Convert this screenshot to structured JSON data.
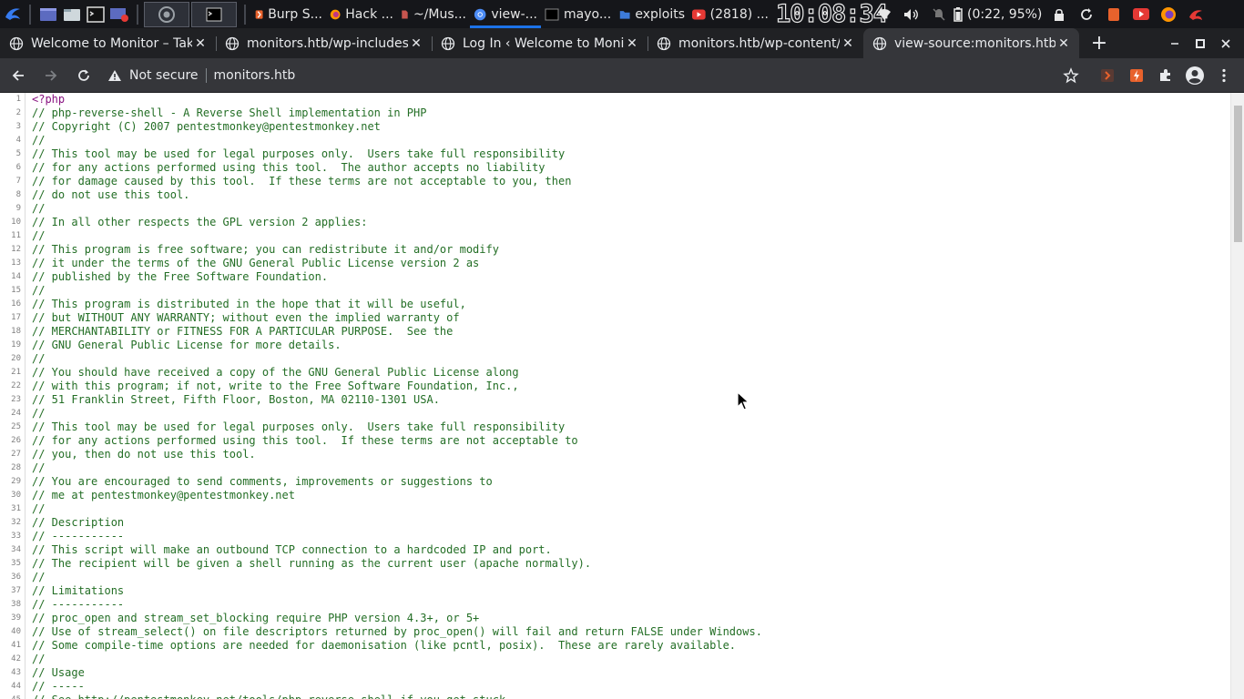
{
  "taskbar": {
    "pinned": [
      {
        "name": "chrome",
        "color": "#4b8bf5"
      },
      {
        "name": "terminal",
        "color": "#dddddd"
      }
    ],
    "tasks": [
      {
        "label": "Burp S...",
        "icon": "burp-icon",
        "color": "#e8622c"
      },
      {
        "label": "Hack ...",
        "icon": "firefox-icon",
        "color": "#ff9500"
      },
      {
        "label": "~/Mus...",
        "icon": "file-icon",
        "color": "#c8554f"
      },
      {
        "label": "view-...",
        "icon": "chrome-icon",
        "color": "#4b8bf5",
        "active": true
      },
      {
        "label": "mayo...",
        "icon": "terminal-icon",
        "color": "#777777"
      },
      {
        "label": "exploits",
        "icon": "folder-icon",
        "color": "#3d7bd9"
      },
      {
        "label": "(2818) ...",
        "icon": "youtube-icon",
        "color": "#e53935"
      }
    ],
    "clock": "10:08:34",
    "battery": "(0:22, 95%)"
  },
  "tabs": [
    {
      "title": "Welcome to Monitor – Taking",
      "active": false
    },
    {
      "title": "monitors.htb/wp-includes/",
      "active": false
    },
    {
      "title": "Log In ‹ Welcome to Monitor",
      "active": false
    },
    {
      "title": "monitors.htb/wp-content/",
      "active": false
    },
    {
      "title": "view-source:monitors.htb/",
      "active": true
    }
  ],
  "toolbar": {
    "security_label": "Not secure",
    "url": "monitors.htb"
  },
  "source": {
    "lines": [
      "<?php",
      "// php-reverse-shell - A Reverse Shell implementation in PHP",
      "// Copyright (C) 2007 pentestmonkey@pentestmonkey.net",
      "//",
      "// This tool may be used for legal purposes only.  Users take full responsibility",
      "// for any actions performed using this tool.  The author accepts no liability",
      "// for damage caused by this tool.  If these terms are not acceptable to you, then",
      "// do not use this tool.",
      "//",
      "// In all other respects the GPL version 2 applies:",
      "//",
      "// This program is free software; you can redistribute it and/or modify",
      "// it under the terms of the GNU General Public License version 2 as",
      "// published by the Free Software Foundation.",
      "//",
      "// This program is distributed in the hope that it will be useful,",
      "// but WITHOUT ANY WARRANTY; without even the implied warranty of",
      "// MERCHANTABILITY or FITNESS FOR A PARTICULAR PURPOSE.  See the",
      "// GNU General Public License for more details.",
      "//",
      "// You should have received a copy of the GNU General Public License along",
      "// with this program; if not, write to the Free Software Foundation, Inc.,",
      "// 51 Franklin Street, Fifth Floor, Boston, MA 02110-1301 USA.",
      "//",
      "// This tool may be used for legal purposes only.  Users take full responsibility",
      "// for any actions performed using this tool.  If these terms are not acceptable to",
      "// you, then do not use this tool.",
      "//",
      "// You are encouraged to send comments, improvements or suggestions to",
      "// me at pentestmonkey@pentestmonkey.net",
      "//",
      "// Description",
      "// -----------",
      "// This script will make an outbound TCP connection to a hardcoded IP and port.",
      "// The recipient will be given a shell running as the current user (apache normally).",
      "//",
      "// Limitations",
      "// -----------",
      "// proc_open and stream_set_blocking require PHP version 4.3+, or 5+",
      "// Use of stream_select() on file descriptors returned by proc_open() will fail and return FALSE under Windows.",
      "// Some compile-time options are needed for daemonisation (like pcntl, posix).  These are rarely available.",
      "//",
      "// Usage",
      "// -----",
      "// See http://pentestmonkey.net/tools/php-reverse-shell if you get stuck."
    ]
  },
  "colors": {
    "comment": "#236e25",
    "php_tag": "#881280",
    "line_number": "#808080"
  }
}
